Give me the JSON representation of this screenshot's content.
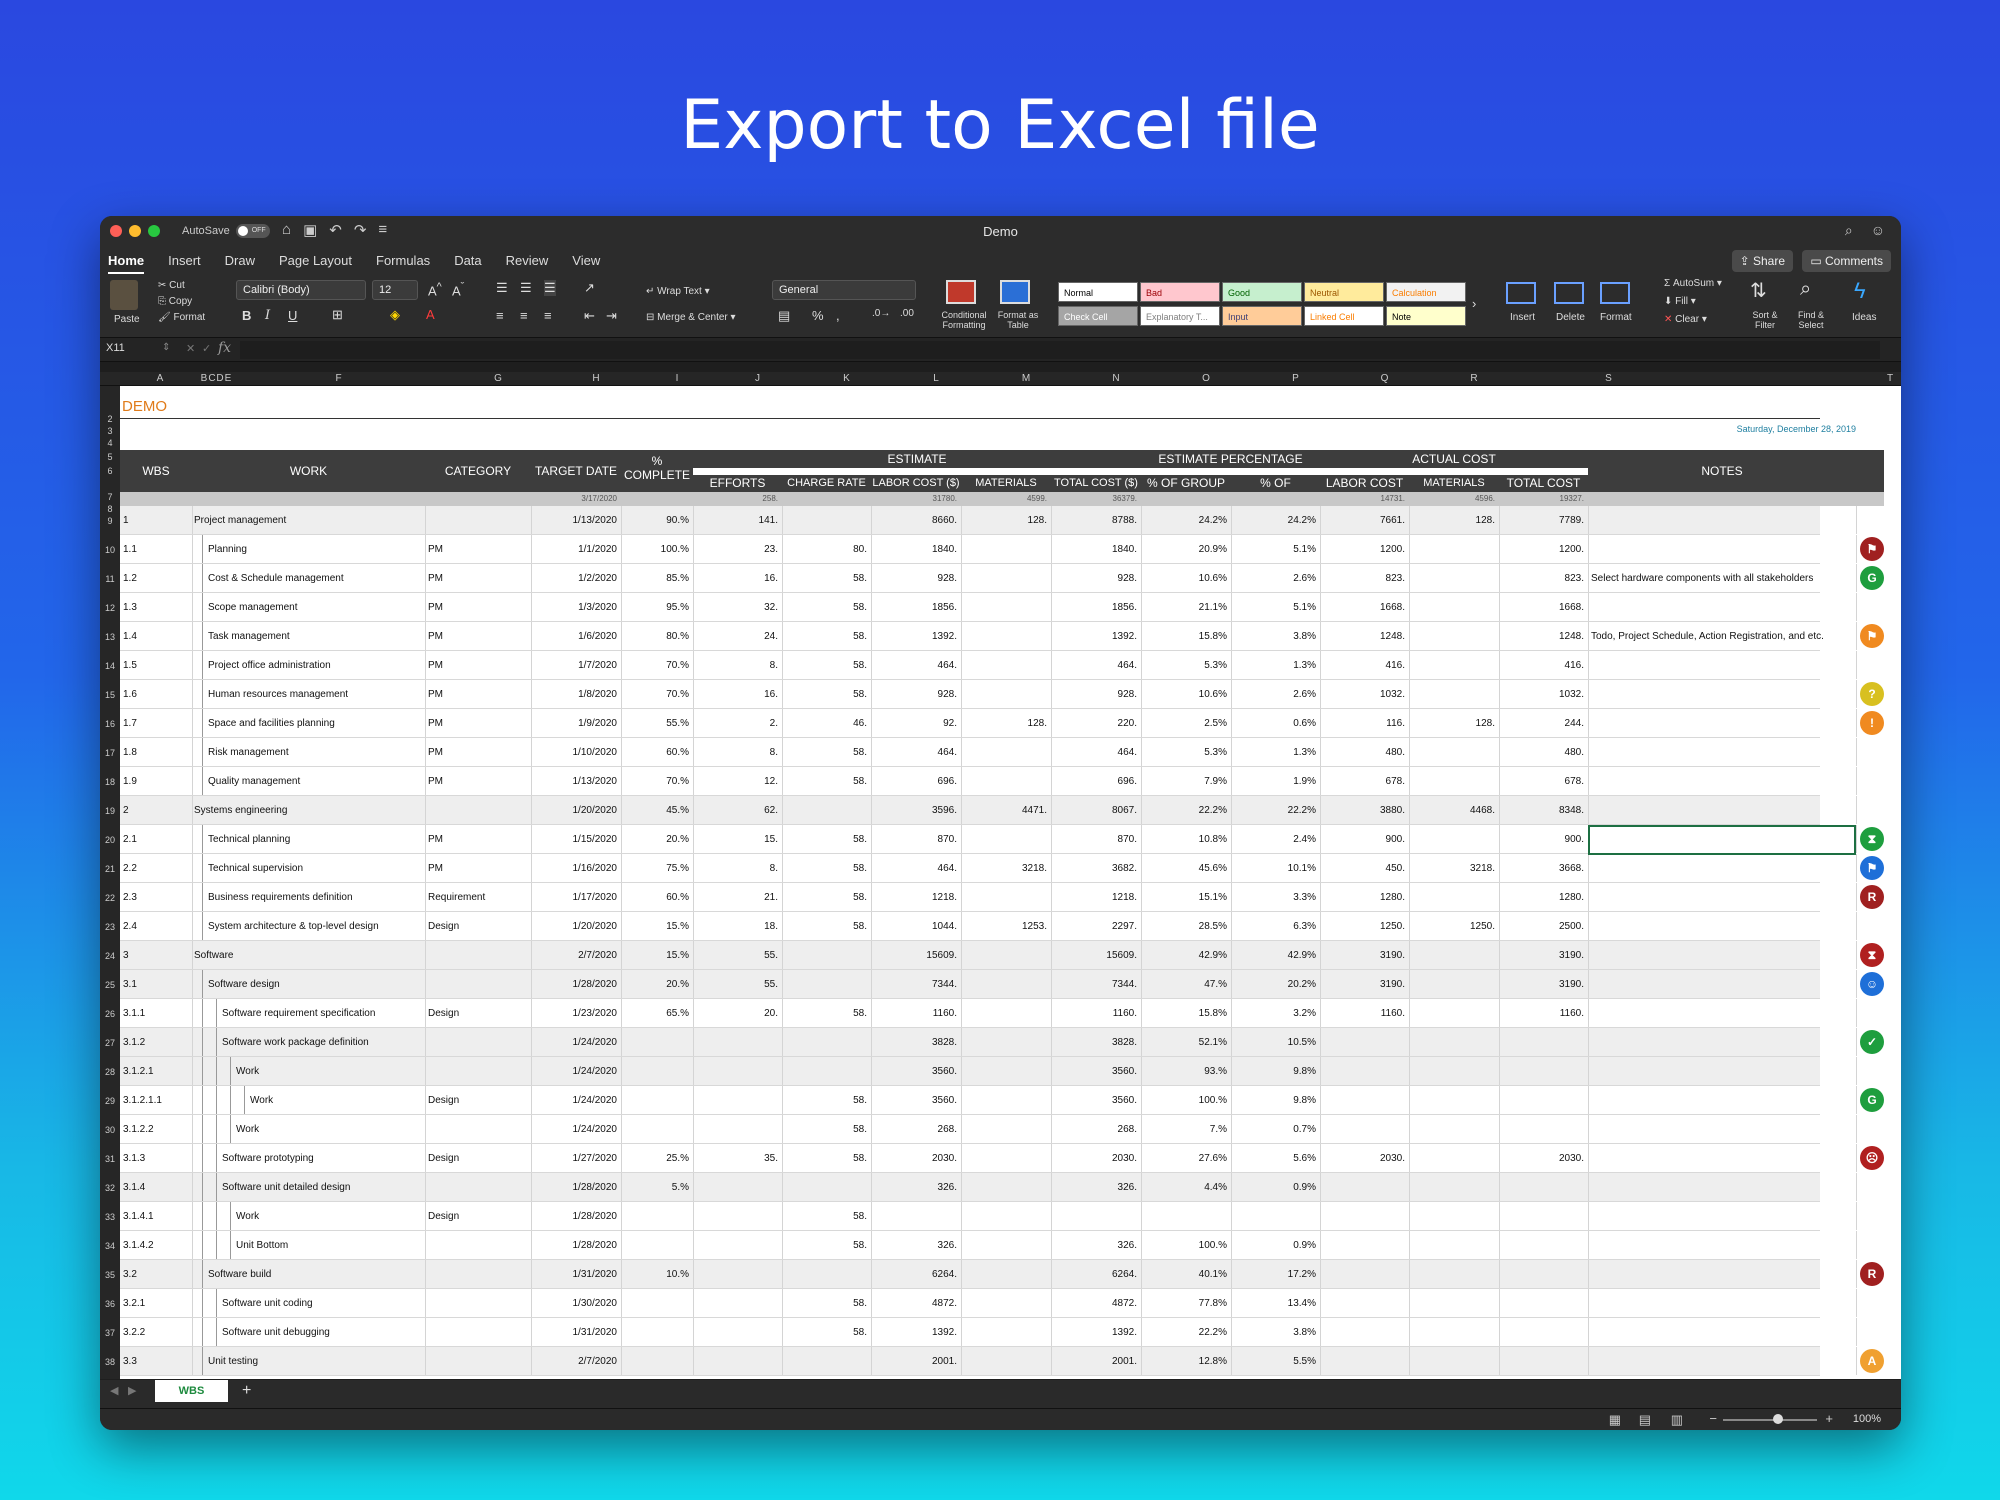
{
  "headline": "Export to Excel file",
  "window": {
    "title": "Demo",
    "autosave_label": "AutoSave",
    "autosave_state": "OFF"
  },
  "menu": {
    "tabs": [
      "Home",
      "Insert",
      "Draw",
      "Page Layout",
      "Formulas",
      "Data",
      "Review",
      "View"
    ],
    "share": "Share",
    "comments": "Comments"
  },
  "ribbon": {
    "paste": "Paste",
    "cut": "Cut",
    "copy": "Copy",
    "format_painter": "Format",
    "font_name": "Calibri (Body)",
    "font_size": "12",
    "wrap_text": "Wrap Text",
    "merge_center": "Merge & Center",
    "number_format": "General",
    "conditional_formatting": "Conditional Formatting",
    "format_as_table": "Format as Table",
    "styles": [
      "Normal",
      "Bad",
      "Good",
      "Neutral",
      "Calculation",
      "Check Cell",
      "Explanatory T...",
      "Input",
      "Linked Cell",
      "Note"
    ],
    "style_colors": [
      "#ffffff",
      "#ffc7ce",
      "#c6efce",
      "#ffeb9c",
      "#f2f2f2",
      "#a5a5a5",
      "#ffffff",
      "#ffcc99",
      "#ffffff",
      "#ffffcc"
    ],
    "style_text_colors": [
      "#000000",
      "#9c0006",
      "#006100",
      "#9c5700",
      "#fa7d00",
      "#ffffff",
      "#7f7f7f",
      "#3f3f76",
      "#fa7d00",
      "#000000"
    ],
    "insert": "Insert",
    "delete": "Delete",
    "format": "Format",
    "autosum": "AutoSum",
    "fill": "Fill",
    "clear": "Clear",
    "sort_filter": "Sort & Filter",
    "find_select": "Find & Select",
    "ideas": "Ideas"
  },
  "formula_bar": {
    "cell_ref": "X11",
    "fx": "fx"
  },
  "columns": [
    "A",
    "B",
    "C",
    "D",
    "E",
    "F",
    "G",
    "H",
    "I",
    "J",
    "K",
    "L",
    "M",
    "N",
    "O",
    "P",
    "Q",
    "R",
    "S",
    "T"
  ],
  "sheet": {
    "title": "DEMO",
    "date": "Saturday, December 28, 2019",
    "headers": {
      "wbs": "WBS",
      "work": "WORK",
      "category": "CATEGORY",
      "target_date": "TARGET DATE",
      "complete": "% COMPLETE",
      "estimate": "ESTIMATE",
      "efforts": "EFFORTS",
      "charge_rate": "CHARGE RATE ($)",
      "labor_cost": "LABOR COST ($)",
      "materials_cost": "MATERIALS COST ($)",
      "total_cost": "TOTAL COST ($)",
      "estimate_percentage": "ESTIMATE PERCENTAGE",
      "pct_group": "% OF GROUP",
      "pct_project": "% OF PROJECT",
      "actual_cost": "ACTUAL COST",
      "actual_labor": "LABOR COST",
      "actual_materials": "MATERIALS COST",
      "actual_total": "TOTAL COST",
      "notes": "NOTES"
    },
    "totals": {
      "target_date": "3/17/2020",
      "efforts": "258.",
      "labor": "31780.",
      "materials": "4599.",
      "total": "36379.",
      "actual_labor": "14731.",
      "actual_materials": "4596.",
      "actual_total": "19327."
    },
    "rows": [
      {
        "n": "9",
        "wbs": "1",
        "work": "Project management",
        "indent": 0,
        "grp": true,
        "cat": "",
        "date": "1/13/2020",
        "pct": "90.%",
        "eff": "141.",
        "rate": "",
        "labor": "8660.",
        "mat": "128.",
        "total": "8788.",
        "pg": "24.2%",
        "pp": "24.2%",
        "al": "7661.",
        "am": "128.",
        "at": "7789.",
        "note": "",
        "icon": "",
        "icolor": ""
      },
      {
        "n": "10",
        "wbs": "1.1",
        "work": "Planning",
        "indent": 1,
        "grp": false,
        "cat": "PM",
        "date": "1/1/2020",
        "pct": "100.%",
        "eff": "23.",
        "rate": "80.",
        "labor": "1840.",
        "mat": "",
        "total": "1840.",
        "pg": "20.9%",
        "pp": "5.1%",
        "al": "1200.",
        "am": "",
        "at": "1200.",
        "note": "",
        "icon": "⚑",
        "icolor": "#a02020"
      },
      {
        "n": "11",
        "wbs": "1.2",
        "work": "Cost & Schedule management",
        "indent": 1,
        "grp": false,
        "cat": "PM",
        "date": "1/2/2020",
        "pct": "85.%",
        "eff": "16.",
        "rate": "58.",
        "labor": "928.",
        "mat": "",
        "total": "928.",
        "pg": "10.6%",
        "pp": "2.6%",
        "al": "823.",
        "am": "",
        "at": "823.",
        "note": "Select hardware components with all stakeholders",
        "icon": "G",
        "icolor": "#1e9e3e"
      },
      {
        "n": "12",
        "wbs": "1.3",
        "work": "Scope management",
        "indent": 1,
        "grp": false,
        "cat": "PM",
        "date": "1/3/2020",
        "pct": "95.%",
        "eff": "32.",
        "rate": "58.",
        "labor": "1856.",
        "mat": "",
        "total": "1856.",
        "pg": "21.1%",
        "pp": "5.1%",
        "al": "1668.",
        "am": "",
        "at": "1668.",
        "note": "",
        "icon": "",
        "icolor": ""
      },
      {
        "n": "13",
        "wbs": "1.4",
        "work": "Task management",
        "indent": 1,
        "grp": false,
        "cat": "PM",
        "date": "1/6/2020",
        "pct": "80.%",
        "eff": "24.",
        "rate": "58.",
        "labor": "1392.",
        "mat": "",
        "total": "1392.",
        "pg": "15.8%",
        "pp": "3.8%",
        "al": "1248.",
        "am": "",
        "at": "1248.",
        "note": "Todo, Project Schedule, Action Registration, and etc.",
        "icon": "⚑",
        "icolor": "#f08a20"
      },
      {
        "n": "14",
        "wbs": "1.5",
        "work": "Project office administration",
        "indent": 1,
        "grp": false,
        "cat": "PM",
        "date": "1/7/2020",
        "pct": "70.%",
        "eff": "8.",
        "rate": "58.",
        "labor": "464.",
        "mat": "",
        "total": "464.",
        "pg": "5.3%",
        "pp": "1.3%",
        "al": "416.",
        "am": "",
        "at": "416.",
        "note": "",
        "icon": "",
        "icolor": ""
      },
      {
        "n": "15",
        "wbs": "1.6",
        "work": "Human resources management",
        "indent": 1,
        "grp": false,
        "cat": "PM",
        "date": "1/8/2020",
        "pct": "70.%",
        "eff": "16.",
        "rate": "58.",
        "labor": "928.",
        "mat": "",
        "total": "928.",
        "pg": "10.6%",
        "pp": "2.6%",
        "al": "1032.",
        "am": "",
        "at": "1032.",
        "note": "",
        "icon": "?",
        "icolor": "#d8c020"
      },
      {
        "n": "16",
        "wbs": "1.7",
        "work": "Space and facilities planning",
        "indent": 1,
        "grp": false,
        "cat": "PM",
        "date": "1/9/2020",
        "pct": "55.%",
        "eff": "2.",
        "rate": "46.",
        "labor": "92.",
        "mat": "128.",
        "total": "220.",
        "pg": "2.5%",
        "pp": "0.6%",
        "al": "116.",
        "am": "128.",
        "at": "244.",
        "note": "",
        "icon": "!",
        "icolor": "#f08a20"
      },
      {
        "n": "17",
        "wbs": "1.8",
        "work": "Risk management",
        "indent": 1,
        "grp": false,
        "cat": "PM",
        "date": "1/10/2020",
        "pct": "60.%",
        "eff": "8.",
        "rate": "58.",
        "labor": "464.",
        "mat": "",
        "total": "464.",
        "pg": "5.3%",
        "pp": "1.3%",
        "al": "480.",
        "am": "",
        "at": "480.",
        "note": "",
        "icon": "",
        "icolor": ""
      },
      {
        "n": "18",
        "wbs": "1.9",
        "work": "Quality management",
        "indent": 1,
        "grp": false,
        "cat": "PM",
        "date": "1/13/2020",
        "pct": "70.%",
        "eff": "12.",
        "rate": "58.",
        "labor": "696.",
        "mat": "",
        "total": "696.",
        "pg": "7.9%",
        "pp": "1.9%",
        "al": "678.",
        "am": "",
        "at": "678.",
        "note": "",
        "icon": "",
        "icolor": ""
      },
      {
        "n": "19",
        "wbs": "2",
        "work": "Systems engineering",
        "indent": 0,
        "grp": true,
        "cat": "",
        "date": "1/20/2020",
        "pct": "45.%",
        "eff": "62.",
        "rate": "",
        "labor": "3596.",
        "mat": "4471.",
        "total": "8067.",
        "pg": "22.2%",
        "pp": "22.2%",
        "al": "3880.",
        "am": "4468.",
        "at": "8348.",
        "note": "",
        "icon": "",
        "icolor": ""
      },
      {
        "n": "20",
        "wbs": "2.1",
        "work": "Technical planning",
        "indent": 1,
        "grp": false,
        "cat": "PM",
        "date": "1/15/2020",
        "pct": "20.%",
        "eff": "15.",
        "rate": "58.",
        "labor": "870.",
        "mat": "",
        "total": "870.",
        "pg": "10.8%",
        "pp": "2.4%",
        "al": "900.",
        "am": "",
        "at": "900.",
        "note": "",
        "icon": "⧗",
        "icolor": "#1e9e3e"
      },
      {
        "n": "21",
        "wbs": "2.2",
        "work": "Technical supervision",
        "indent": 1,
        "grp": false,
        "cat": "PM",
        "date": "1/16/2020",
        "pct": "75.%",
        "eff": "8.",
        "rate": "58.",
        "labor": "464.",
        "mat": "3218.",
        "total": "3682.",
        "pg": "45.6%",
        "pp": "10.1%",
        "al": "450.",
        "am": "3218.",
        "at": "3668.",
        "note": "",
        "icon": "⚑",
        "icolor": "#1e6fd8"
      },
      {
        "n": "22",
        "wbs": "2.3",
        "work": "Business requirements definition",
        "indent": 1,
        "grp": false,
        "cat": "Requirement",
        "date": "1/17/2020",
        "pct": "60.%",
        "eff": "21.",
        "rate": "58.",
        "labor": "1218.",
        "mat": "",
        "total": "1218.",
        "pg": "15.1%",
        "pp": "3.3%",
        "al": "1280.",
        "am": "",
        "at": "1280.",
        "note": "",
        "icon": "R",
        "icolor": "#a02020"
      },
      {
        "n": "23",
        "wbs": "2.4",
        "work": "System architecture & top-level design",
        "indent": 1,
        "grp": false,
        "cat": "Design",
        "date": "1/20/2020",
        "pct": "15.%",
        "eff": "18.",
        "rate": "58.",
        "labor": "1044.",
        "mat": "1253.",
        "total": "2297.",
        "pg": "28.5%",
        "pp": "6.3%",
        "al": "1250.",
        "am": "1250.",
        "at": "2500.",
        "note": "",
        "icon": "",
        "icolor": ""
      },
      {
        "n": "24",
        "wbs": "3",
        "work": "Software",
        "indent": 0,
        "grp": true,
        "cat": "",
        "date": "2/7/2020",
        "pct": "15.%",
        "eff": "55.",
        "rate": "",
        "labor": "15609.",
        "mat": "",
        "total": "15609.",
        "pg": "42.9%",
        "pp": "42.9%",
        "al": "3190.",
        "am": "",
        "at": "3190.",
        "note": "",
        "icon": "⧗",
        "icolor": "#b02020"
      },
      {
        "n": "25",
        "wbs": "3.1",
        "work": "Software design",
        "indent": 1,
        "grp": true,
        "cat": "",
        "date": "1/28/2020",
        "pct": "20.%",
        "eff": "55.",
        "rate": "",
        "labor": "7344.",
        "mat": "",
        "total": "7344.",
        "pg": "47.%",
        "pp": "20.2%",
        "al": "3190.",
        "am": "",
        "at": "3190.",
        "note": "",
        "icon": "☺",
        "icolor": "#1e6fd8"
      },
      {
        "n": "26",
        "wbs": "3.1.1",
        "work": "Software requirement specification",
        "indent": 2,
        "grp": false,
        "cat": "Design",
        "date": "1/23/2020",
        "pct": "65.%",
        "eff": "20.",
        "rate": "58.",
        "labor": "1160.",
        "mat": "",
        "total": "1160.",
        "pg": "15.8%",
        "pp": "3.2%",
        "al": "1160.",
        "am": "",
        "at": "1160.",
        "note": "",
        "icon": "",
        "icolor": ""
      },
      {
        "n": "27",
        "wbs": "3.1.2",
        "work": "Software work package definition",
        "indent": 2,
        "grp": true,
        "cat": "",
        "date": "1/24/2020",
        "pct": "",
        "eff": "",
        "rate": "",
        "labor": "3828.",
        "mat": "",
        "total": "3828.",
        "pg": "52.1%",
        "pp": "10.5%",
        "al": "",
        "am": "",
        "at": "",
        "note": "",
        "icon": "✓",
        "icolor": "#1e9e3e"
      },
      {
        "n": "28",
        "wbs": "3.1.2.1",
        "work": "Work",
        "indent": 3,
        "grp": true,
        "cat": "",
        "date": "1/24/2020",
        "pct": "",
        "eff": "",
        "rate": "",
        "labor": "3560.",
        "mat": "",
        "total": "3560.",
        "pg": "93.%",
        "pp": "9.8%",
        "al": "",
        "am": "",
        "at": "",
        "note": "",
        "icon": "",
        "icolor": ""
      },
      {
        "n": "29",
        "wbs": "3.1.2.1.1",
        "work": "Work",
        "indent": 4,
        "grp": false,
        "cat": "Design",
        "date": "1/24/2020",
        "pct": "",
        "eff": "",
        "rate": "58.",
        "labor": "3560.",
        "mat": "",
        "total": "3560.",
        "pg": "100.%",
        "pp": "9.8%",
        "al": "",
        "am": "",
        "at": "",
        "note": "",
        "icon": "G",
        "icolor": "#1e9e3e"
      },
      {
        "n": "30",
        "wbs": "3.1.2.2",
        "work": "Work",
        "indent": 3,
        "grp": false,
        "cat": "",
        "date": "1/24/2020",
        "pct": "",
        "eff": "",
        "rate": "58.",
        "labor": "268.",
        "mat": "",
        "total": "268.",
        "pg": "7.%",
        "pp": "0.7%",
        "al": "",
        "am": "",
        "at": "",
        "note": "",
        "icon": "",
        "icolor": ""
      },
      {
        "n": "31",
        "wbs": "3.1.3",
        "work": "Software prototyping",
        "indent": 2,
        "grp": false,
        "cat": "Design",
        "date": "1/27/2020",
        "pct": "25.%",
        "eff": "35.",
        "rate": "58.",
        "labor": "2030.",
        "mat": "",
        "total": "2030.",
        "pg": "27.6%",
        "pp": "5.6%",
        "al": "2030.",
        "am": "",
        "at": "2030.",
        "note": "",
        "icon": "☹",
        "icolor": "#b02020"
      },
      {
        "n": "32",
        "wbs": "3.1.4",
        "work": "Software unit detailed design",
        "indent": 2,
        "grp": true,
        "cat": "",
        "date": "1/28/2020",
        "pct": "5.%",
        "eff": "",
        "rate": "",
        "labor": "326.",
        "mat": "",
        "total": "326.",
        "pg": "4.4%",
        "pp": "0.9%",
        "al": "",
        "am": "",
        "at": "",
        "note": "",
        "icon": "",
        "icolor": ""
      },
      {
        "n": "33",
        "wbs": "3.1.4.1",
        "work": "Work",
        "indent": 3,
        "grp": false,
        "cat": "Design",
        "date": "1/28/2020",
        "pct": "",
        "eff": "",
        "rate": "58.",
        "labor": "",
        "mat": "",
        "total": "",
        "pg": "",
        "pp": "",
        "al": "",
        "am": "",
        "at": "",
        "note": "",
        "icon": "",
        "icolor": ""
      },
      {
        "n": "34",
        "wbs": "3.1.4.2",
        "work": "Unit Bottom",
        "indent": 3,
        "grp": false,
        "cat": "",
        "date": "1/28/2020",
        "pct": "",
        "eff": "",
        "rate": "58.",
        "labor": "326.",
        "mat": "",
        "total": "326.",
        "pg": "100.%",
        "pp": "0.9%",
        "al": "",
        "am": "",
        "at": "",
        "note": "",
        "icon": "",
        "icolor": ""
      },
      {
        "n": "35",
        "wbs": "3.2",
        "work": "Software build",
        "indent": 1,
        "grp": true,
        "cat": "",
        "date": "1/31/2020",
        "pct": "10.%",
        "eff": "",
        "rate": "",
        "labor": "6264.",
        "mat": "",
        "total": "6264.",
        "pg": "40.1%",
        "pp": "17.2%",
        "al": "",
        "am": "",
        "at": "",
        "note": "",
        "icon": "R",
        "icolor": "#a02020"
      },
      {
        "n": "36",
        "wbs": "3.2.1",
        "work": "Software unit coding",
        "indent": 2,
        "grp": false,
        "cat": "",
        "date": "1/30/2020",
        "pct": "",
        "eff": "",
        "rate": "58.",
        "labor": "4872.",
        "mat": "",
        "total": "4872.",
        "pg": "77.8%",
        "pp": "13.4%",
        "al": "",
        "am": "",
        "at": "",
        "note": "",
        "icon": "",
        "icolor": ""
      },
      {
        "n": "37",
        "wbs": "3.2.2",
        "work": "Software unit debugging",
        "indent": 2,
        "grp": false,
        "cat": "",
        "date": "1/31/2020",
        "pct": "",
        "eff": "",
        "rate": "58.",
        "labor": "1392.",
        "mat": "",
        "total": "1392.",
        "pg": "22.2%",
        "pp": "3.8%",
        "al": "",
        "am": "",
        "at": "",
        "note": "",
        "icon": "",
        "icolor": ""
      },
      {
        "n": "38",
        "wbs": "3.3",
        "work": "Unit testing",
        "indent": 1,
        "grp": true,
        "cat": "",
        "date": "2/7/2020",
        "pct": "",
        "eff": "",
        "rate": "",
        "labor": "2001.",
        "mat": "",
        "total": "2001.",
        "pg": "12.8%",
        "pp": "5.5%",
        "al": "",
        "am": "",
        "at": "",
        "note": "",
        "icon": "A",
        "icolor": "#f0a030"
      }
    ]
  },
  "sheet_tab": "WBS",
  "add_sheet": "+",
  "zoom": "100%"
}
